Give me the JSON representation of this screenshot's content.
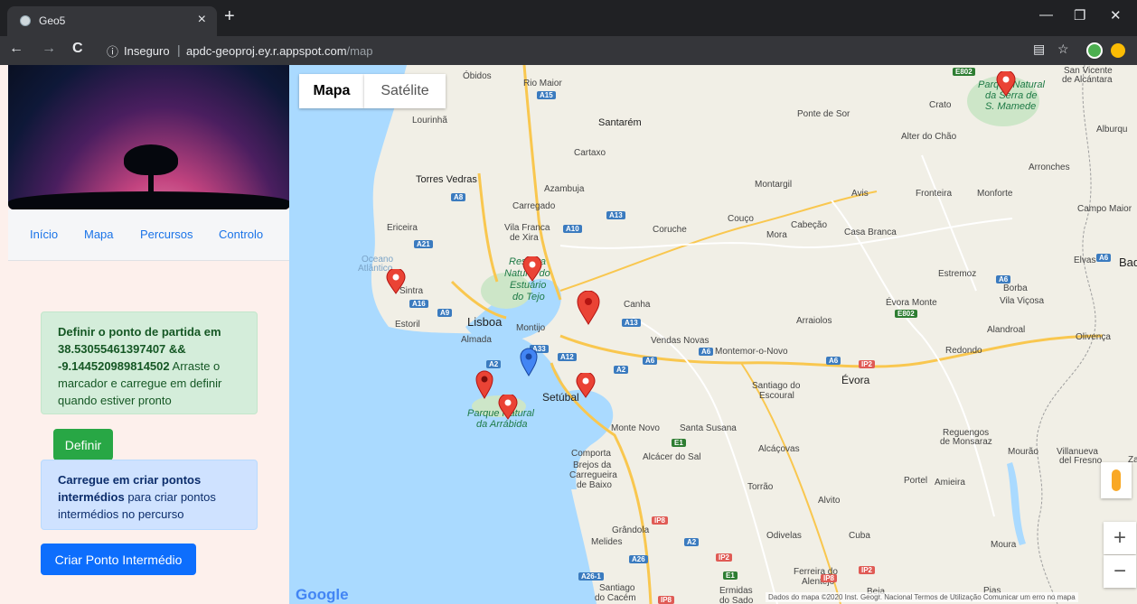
{
  "browser": {
    "tab_title": "Geo5",
    "tab_close": "×",
    "new_tab": "+",
    "security_label": "Inseguro",
    "url_host": "apdc-geoproj.ey.r.appspot.com",
    "url_path": "/map"
  },
  "nav": {
    "items": [
      {
        "label": "Início"
      },
      {
        "label": "Mapa"
      },
      {
        "label": "Percursos"
      },
      {
        "label": "Controlo"
      }
    ]
  },
  "start_point": {
    "title": "Definir o ponto de partida em",
    "coords": "38.53055461397407 && -9.144520989814502",
    "instruction": "Arraste o marcador e carregue em definir quando estiver pronto",
    "button_label": "Definir"
  },
  "intermediate": {
    "bold_text": "Carregue em criar pontos intermédios",
    "rest_text": "para criar pontos intermédios no percurso",
    "button_label": "Criar Ponto Intermédio"
  },
  "map": {
    "type_tabs": [
      {
        "label": "Mapa"
      },
      {
        "label": "Satélite"
      }
    ],
    "zoom_in": "+",
    "zoom_out": "−",
    "logo": "Google",
    "attribution": "Dados do mapa ©2020 Inst. Geogr. Nacional    Termos de Utilização    Comunicar um erro no mapa",
    "labels": {
      "obidos": "Óbidos",
      "rio_maior": "Rio Maior",
      "lourinha": "Lourinhã",
      "santarem": "Santarém",
      "cartaxo": "Cartaxo",
      "torres_vedras": "Torres Vedras",
      "azambuja": "Azambuja",
      "carregado": "Carregado",
      "vila_franca": "Vila Franca",
      "de_xira": "de Xira",
      "ericeira": "Ericeira",
      "oceano": "Oceano",
      "atlantico": "Atlântico",
      "sintra": "Sintra",
      "estoril": "Estoril",
      "lisboa": "Lisboa",
      "almada": "Almada",
      "montijo": "Montijo",
      "canha": "Canha",
      "coruche": "Coruche",
      "couco": "Couço",
      "cabecao": "Cabeção",
      "mora": "Mora",
      "casa_branca": "Casa Branca",
      "montargil": "Montargil",
      "avis": "Avis",
      "fronteira": "Fronteira",
      "monforte": "Monforte",
      "ponte_de_sor": "Ponte de Sor",
      "crato": "Crato",
      "alter_do_chao": "Alter do Chão",
      "arronches": "Arronches",
      "campo_maior": "Campo Maior",
      "elvas": "Elvas",
      "badajoz": "Bad",
      "estremoz": "Estremoz",
      "borba": "Borba",
      "vila_vicosa": "Vila Viçosa",
      "evora_monte": "Évora Monte",
      "arraiolos": "Arraiolos",
      "vendas_novas": "Vendas Novas",
      "montemor": "Montemor-o-Novo",
      "evora": "Évora",
      "redondo": "Redondo",
      "alandroal": "Alandroal",
      "olivenca": "Olivença",
      "setubal": "Setúbal",
      "parque_arrabida_1": "Parque Natural",
      "parque_arrabida_2": "da Arrábida",
      "reserva_1": "Reserva",
      "reserva_2": "Natural do",
      "reserva_3": "Estuário",
      "reserva_4": "do Tejo",
      "parque_serra_1": "Parque Natural",
      "parque_serra_2": "da Serra de",
      "parque_serra_3": "S. Mamede",
      "santiago_escoural_1": "Santiago do",
      "santiago_escoural_2": "Escoural",
      "reguengos_1": "Reguengos",
      "reguengos_2": "de Monsaraz",
      "monte_novo": "Monte Novo",
      "santa_susana": "Santa Susana",
      "alcacovas": "Alcáçovas",
      "mourao": "Mourão",
      "villanueva_1": "Villanueva",
      "villanueva_2": "del Fresno",
      "comporta": "Comporta",
      "brejos_1": "Brejos da",
      "brejos_2": "Carregueira",
      "brejos_3": "de Baixo",
      "alcacer": "Alcácer do Sal",
      "torrao": "Torrão",
      "portel": "Portel",
      "amieira": "Amieira",
      "alvito": "Alvito",
      "grandola": "Grândola",
      "melides": "Melides",
      "odivelas": "Odivelas",
      "cuba": "Cuba",
      "moura": "Moura",
      "ferreira_1": "Ferreira do",
      "ferreira_2": "Alentejo",
      "santiago_cacem_1": "Santiago",
      "santiago_cacem_2": "do Cacém",
      "ermidas_1": "Ermidas",
      "ermidas_2": "do Sado",
      "beja": "Beja",
      "pias": "Pias",
      "san_vicente_1": "San Vicente",
      "san_vicente_2": "de Alcántara",
      "alburquerque": "Alburqu",
      "za": "Za"
    },
    "shields": {
      "a15": "A15",
      "a8": "A8",
      "a13a": "A13",
      "a10": "A10",
      "a21": "A21",
      "a16": "A16",
      "a9": "A9",
      "a2a": "A2",
      "a33": "A33",
      "a12": "A12",
      "a13b": "A13",
      "a6a": "A6",
      "a2b": "A2",
      "a6b": "A6",
      "a6c": "A6",
      "a6d": "A6",
      "a6e": "A6",
      "ip2a": "IP2",
      "ip2b": "IP2",
      "ip2c": "IP2",
      "ip8a": "IP8",
      "ip8b": "IP8",
      "ip8c": "IP8",
      "e802a": "E802",
      "e802b": "E802",
      "e1a": "E1",
      "e1b": "E1",
      "a2c": "A2",
      "a26": "A26",
      "a261": "A26-1"
    }
  },
  "colors": {
    "success_bg": "#d4edda",
    "success_button": "#28a745",
    "primary_button": "#0d6efd",
    "info_bg": "#cfe2ff",
    "map_water": "#aadaff",
    "map_land": "#f1efe6",
    "marker_red": "#ea4335",
    "marker_blue": "#4285f4"
  }
}
